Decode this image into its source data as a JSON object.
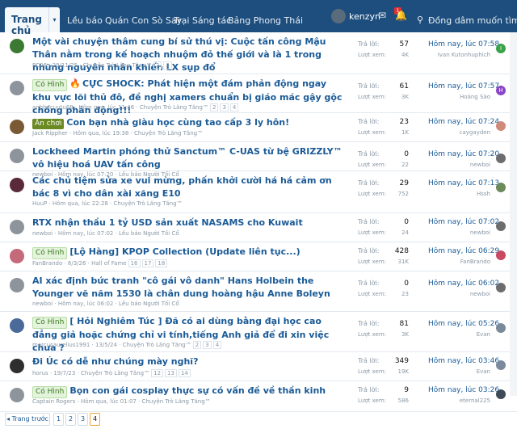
{
  "nav": {
    "active_tab": "Trang chủ",
    "links": [
      "Lều báo",
      "Quán Con Sò Say",
      "Trại Sáng tác",
      "Bảng Phong Thái"
    ],
    "username": "kenzyn",
    "notification_count": "1",
    "search_placeholder": "Đồng dâm muốn tìm gì?"
  },
  "stats_labels": {
    "replies": "Trả lời:",
    "views": "Lượt xem:"
  },
  "threads": [
    {
      "avatar": "green",
      "prefix": "",
      "fire": false,
      "title": "Một vài chuyện thâm cung bí sử thú vị: Cuộc tấn công Mậu Thân nằm trong kế hoạch nhuộm đỏ thế giới và là 1 trong những nguyên nhân khiến LX sụp đổ",
      "meta": "PC06 · 29/11/25 · Chuyện Trò Lăng Tăng™",
      "pages": [
        "2",
        "3"
      ],
      "replies": "57",
      "views": "4K",
      "last_time": "Hôm nay, lúc 07:58",
      "last_user": "Ivan Kutonhuphich",
      "lp_letter": "I",
      "lp_color": "#3aa34a"
    },
    {
      "avatar": "grey",
      "prefix": "Có Hình",
      "fire": true,
      "title": "CỰC SHOCK: Phát hiện một đám phản động ngay khu vực lõi thủ đô, đề nghị xamers chuẩn bị giáo mác gậy gộc chống phản động!!!",
      "meta": "anhbacuutu88 · Hôm qua, lúc 11:46 · Chuyện Trò Lăng Tăng™",
      "pages": [
        "2",
        "3",
        "4"
      ],
      "replies": "61",
      "views": "3K",
      "last_time": "Hôm nay, lúc 07:57",
      "last_user": "Hoàng Sào",
      "lp_letter": "H",
      "lp_color": "#8b45c8"
    },
    {
      "avatar": "brown",
      "prefix": "Ăn chơi",
      "fire": false,
      "title": "Con bạn nhà giàu học cùng tao cấp 3 ly hôn!",
      "meta": "Jack Rippher · Hôm qua, lúc 19:38 · Chuyện Trò Lăng Tăng™",
      "pages": [],
      "replies": "23",
      "views": "1K",
      "last_time": "Hôm nay, lúc 07:24",
      "last_user": "caygayden",
      "lp_letter": "",
      "lp_color": "#d08a7a"
    },
    {
      "avatar": "grey",
      "prefix": "",
      "fire": false,
      "title": "Lockheed Martin phóng thử Sanctum™ C-UAS từ bệ GRIZZLY™ vô hiệu hoá UAV tấn công",
      "meta": "newboi · Hôm nay, lúc 07:20 · Lều báo Người Tối Cổ",
      "pages": [],
      "replies": "0",
      "views": "22",
      "last_time": "Hôm nay, lúc 07:20",
      "last_user": "newboi",
      "lp_letter": "",
      "lp_color": "#6d6d6d"
    },
    {
      "avatar": "plum",
      "prefix": "",
      "fire": false,
      "title": "Các chủ tiệm sửa xe vui mừng, phấn khởi cười há há cảm ơn bác 8 vì cho dân xài xăng E10",
      "meta": "HuuP · Hôm qua, lúc 22:28 · Chuyện Trò Lăng Tăng™",
      "pages": [],
      "replies": "29",
      "views": "752",
      "last_time": "Hôm nay, lúc 07:13",
      "last_user": "Hssh",
      "lp_letter": "",
      "lp_color": "#6c8a5a"
    },
    {
      "avatar": "grey",
      "prefix": "",
      "fire": false,
      "title": "RTX nhận thầu 1 tỷ USD sản xuất NASAMS cho Kuwait",
      "meta": "newboi · Hôm nay, lúc 07:02 · Lều báo Người Tối Cổ",
      "pages": [],
      "replies": "0",
      "views": "24",
      "last_time": "Hôm nay, lúc 07:02",
      "last_user": "newboi",
      "lp_letter": "",
      "lp_color": "#6d6d6d"
    },
    {
      "avatar": "pink",
      "prefix": "Có Hình",
      "fire": false,
      "title": "[Lộ Hàng] KPOP Collection (Update liên tục...)",
      "meta": "FanBrando · 6/3/26 · Hall of Fame",
      "pages": [
        "16",
        "17",
        "18"
      ],
      "replies": "428",
      "views": "31K",
      "last_time": "Hôm nay, lúc 06:29",
      "last_user": "FanBrando",
      "lp_letter": "",
      "lp_color": "#c94a60"
    },
    {
      "avatar": "grey",
      "prefix": "",
      "fire": false,
      "title": "AI xác định bức tranh \"cô gái vô danh\" Hans Holbein the Younger vẽ năm 1530 là chân dung hoàng hậu Anne Boleyn",
      "meta": "newboi · Hôm nay, lúc 06:02 · Lều báo Người Tối Cổ",
      "pages": [],
      "replies": "0",
      "views": "23",
      "last_time": "Hôm nay, lúc 06:02",
      "last_user": "newboi",
      "lp_letter": "",
      "lp_color": "#6d6d6d"
    },
    {
      "avatar": "blue",
      "prefix": "Có Hình",
      "fire": false,
      "title": "[ Hỏi Nghiêm Túc ] Đã có ai dùng bằng đại học cao đẳng giả hoặc chứng chỉ vi tính,tiếng Anh giả để đi xin việc chưa ?",
      "meta": "marcusaurelius1991 · 13/5/24 · Chuyện Trò Lăng Tăng™",
      "pages": [
        "2",
        "3",
        "4"
      ],
      "replies": "81",
      "views": "3K",
      "last_time": "Hôm nay, lúc 05:26",
      "last_user": "Evan",
      "lp_letter": "",
      "lp_color": "#7a8a9a"
    },
    {
      "avatar": "dark",
      "prefix": "",
      "fire": false,
      "title": "Đi Úc có dễ như chúng mày nghĩ?",
      "meta": "horus · 19/7/23 · Chuyện Trò Lăng Tăng™",
      "pages": [
        "12",
        "13",
        "14"
      ],
      "replies": "349",
      "views": "19K",
      "last_time": "Hôm nay, lúc 03:46",
      "last_user": "Evan",
      "lp_letter": "",
      "lp_color": "#7a8a9a"
    },
    {
      "avatar": "grey",
      "prefix": "Có Hình",
      "fire": false,
      "title": "Bọn con gái cosplay thực sự có vấn đề về thần kinh",
      "meta": "Captain Rogers · Hôm qua, lúc 01:07 · Chuyện Trò Lăng Tăng™",
      "pages": [],
      "replies": "9",
      "views": "586",
      "last_time": "Hôm nay, lúc 03:26",
      "last_user": "eternal225",
      "lp_letter": "",
      "lp_color": "#3e4a56"
    }
  ],
  "pager": {
    "prev": "◂ Trang trước",
    "pages": [
      "1",
      "2",
      "3",
      "4"
    ],
    "current": "4"
  }
}
